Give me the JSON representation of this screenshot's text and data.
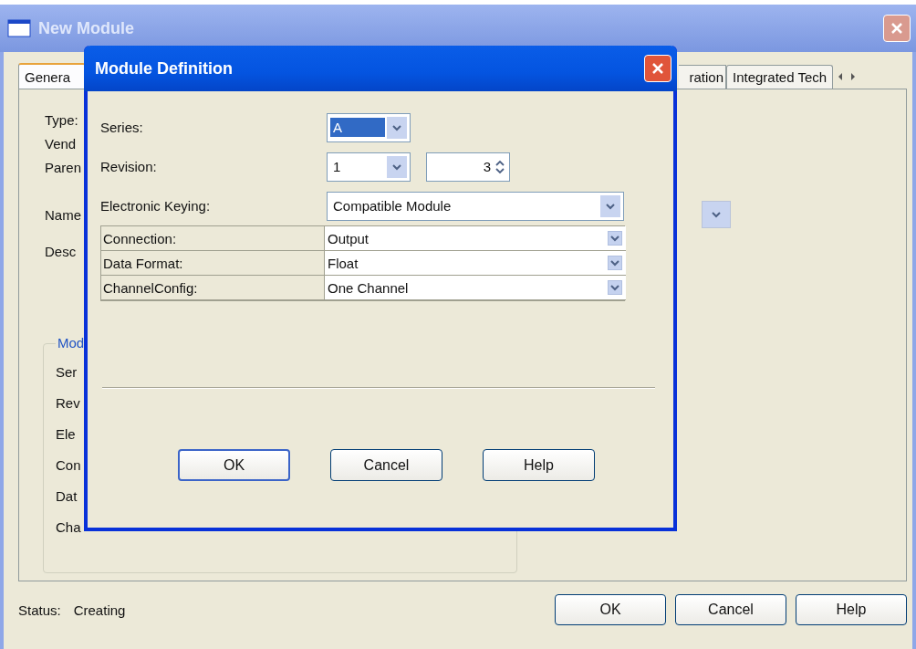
{
  "main_window": {
    "title": "New Module",
    "tabs": [
      {
        "label": "Genera",
        "selected": true
      },
      {
        "label": "ration",
        "selected": false
      },
      {
        "label": "Integrated Tech",
        "selected": false
      }
    ],
    "labels": [
      {
        "text": "Type:",
        "kind": "text"
      },
      {
        "text": "Vend",
        "kind": "text"
      },
      {
        "text": "Paren",
        "kind": "text"
      },
      {
        "text": "Name",
        "kind": "dropdown"
      },
      {
        "text": "Desc",
        "kind": "text"
      }
    ],
    "group": {
      "title": "Mod",
      "labels": [
        "Ser",
        "Rev",
        "Ele",
        "Con",
        "Dat",
        "Cha"
      ]
    },
    "status": {
      "label": "Status:",
      "value": "Creating"
    },
    "buttons": [
      "OK",
      "Cancel",
      "Help"
    ]
  },
  "dialog": {
    "title": "Module Definition",
    "fields": [
      {
        "label": "Series:",
        "kind": "combo",
        "value": "A",
        "highlighted": true
      },
      {
        "label": "Revision:",
        "kind": "combo_spinner",
        "value": "1",
        "spinner_value": "3",
        "highlighted": false
      },
      {
        "label": "Electronic Keying:",
        "kind": "wide_combo",
        "value": "Compatible Module",
        "highlighted": false
      }
    ],
    "grid": [
      {
        "name": "Connection:",
        "value": "Output"
      },
      {
        "name": "Data Format:",
        "value": "Float"
      },
      {
        "name": "ChannelConfig:",
        "value": "One Channel"
      }
    ],
    "buttons": [
      {
        "label": "OK",
        "default": true
      },
      {
        "label": "Cancel",
        "default": false
      },
      {
        "label": "Help",
        "default": false
      }
    ]
  }
}
